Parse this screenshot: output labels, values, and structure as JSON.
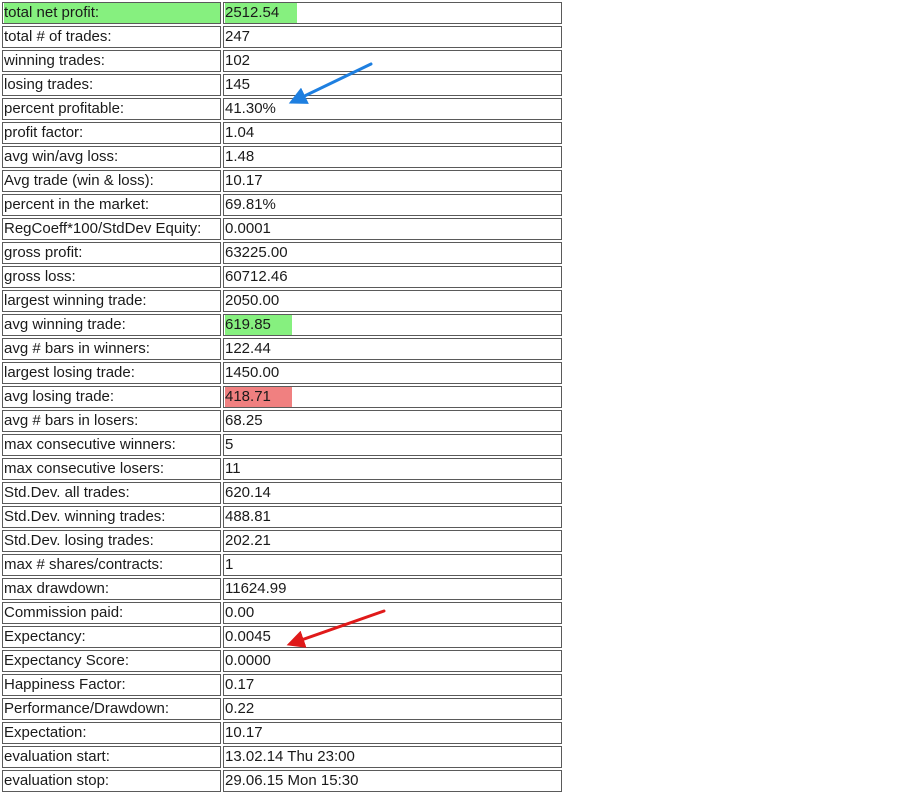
{
  "rows": [
    {
      "label": "total net profit:",
      "value": "2512.54",
      "highlight_label": "green",
      "highlight_value": "green"
    },
    {
      "label": "total # of trades:",
      "value": "247"
    },
    {
      "label": "winning trades:",
      "value": "102"
    },
    {
      "label": "losing trades:",
      "value": "145"
    },
    {
      "label": "percent profitable:",
      "value": "41.30%"
    },
    {
      "label": "profit factor:",
      "value": "1.04"
    },
    {
      "label": "avg win/avg loss:",
      "value": "1.48"
    },
    {
      "label": "Avg trade (win & loss):",
      "value": "10.17"
    },
    {
      "label": "percent in the market:",
      "value": "69.81%"
    },
    {
      "label": "RegCoeff*100/StdDev Equity:",
      "value": "0.0001"
    },
    {
      "label": "gross profit:",
      "value": "63225.00"
    },
    {
      "label": "gross loss:",
      "value": "60712.46"
    },
    {
      "label": "largest winning trade:",
      "value": "2050.00"
    },
    {
      "label": "avg winning trade:",
      "value": "619.85",
      "highlight_value": "green"
    },
    {
      "label": "avg # bars in winners:",
      "value": "122.44"
    },
    {
      "label": "largest losing trade:",
      "value": "1450.00"
    },
    {
      "label": "avg losing trade:",
      "value": "418.71",
      "highlight_value": "red"
    },
    {
      "label": "avg # bars in losers:",
      "value": "68.25"
    },
    {
      "label": "max consecutive winners:",
      "value": "5"
    },
    {
      "label": "max consecutive losers:",
      "value": "11"
    },
    {
      "label": "Std.Dev. all trades:",
      "value": "620.14"
    },
    {
      "label": "Std.Dev. winning trades:",
      "value": "488.81"
    },
    {
      "label": "Std.Dev. losing trades:",
      "value": "202.21"
    },
    {
      "label": "max # shares/contracts:",
      "value": "1"
    },
    {
      "label": "max drawdown:",
      "value": "11624.99"
    },
    {
      "label": "Commission paid:",
      "value": "0.00"
    },
    {
      "label": "Expectancy:",
      "value": "0.0045"
    },
    {
      "label": "Expectancy Score:",
      "value": "0.0000"
    },
    {
      "label": "Happiness Factor:",
      "value": "0.17"
    },
    {
      "label": "Performance/Drawdown:",
      "value": "0.22"
    },
    {
      "label": "Expectation:",
      "value": "10.17"
    },
    {
      "label": "evaluation start:",
      "value": "13.02.14 Thu 23:00"
    },
    {
      "label": "evaluation stop:",
      "value": "29.06.15 Mon 15:30"
    }
  ],
  "colors": {
    "highlight_green": "#86f07f",
    "highlight_red": "#f08080",
    "arrow_blue": "#1e7fe0",
    "arrow_red": "#e01a1a",
    "cell_border": "#5a5a5a"
  },
  "annotations": {
    "blue_arrow": {
      "color": "blue",
      "points_to": "percent profitable"
    },
    "red_arrow": {
      "color": "red",
      "points_to": "Expectancy"
    }
  }
}
